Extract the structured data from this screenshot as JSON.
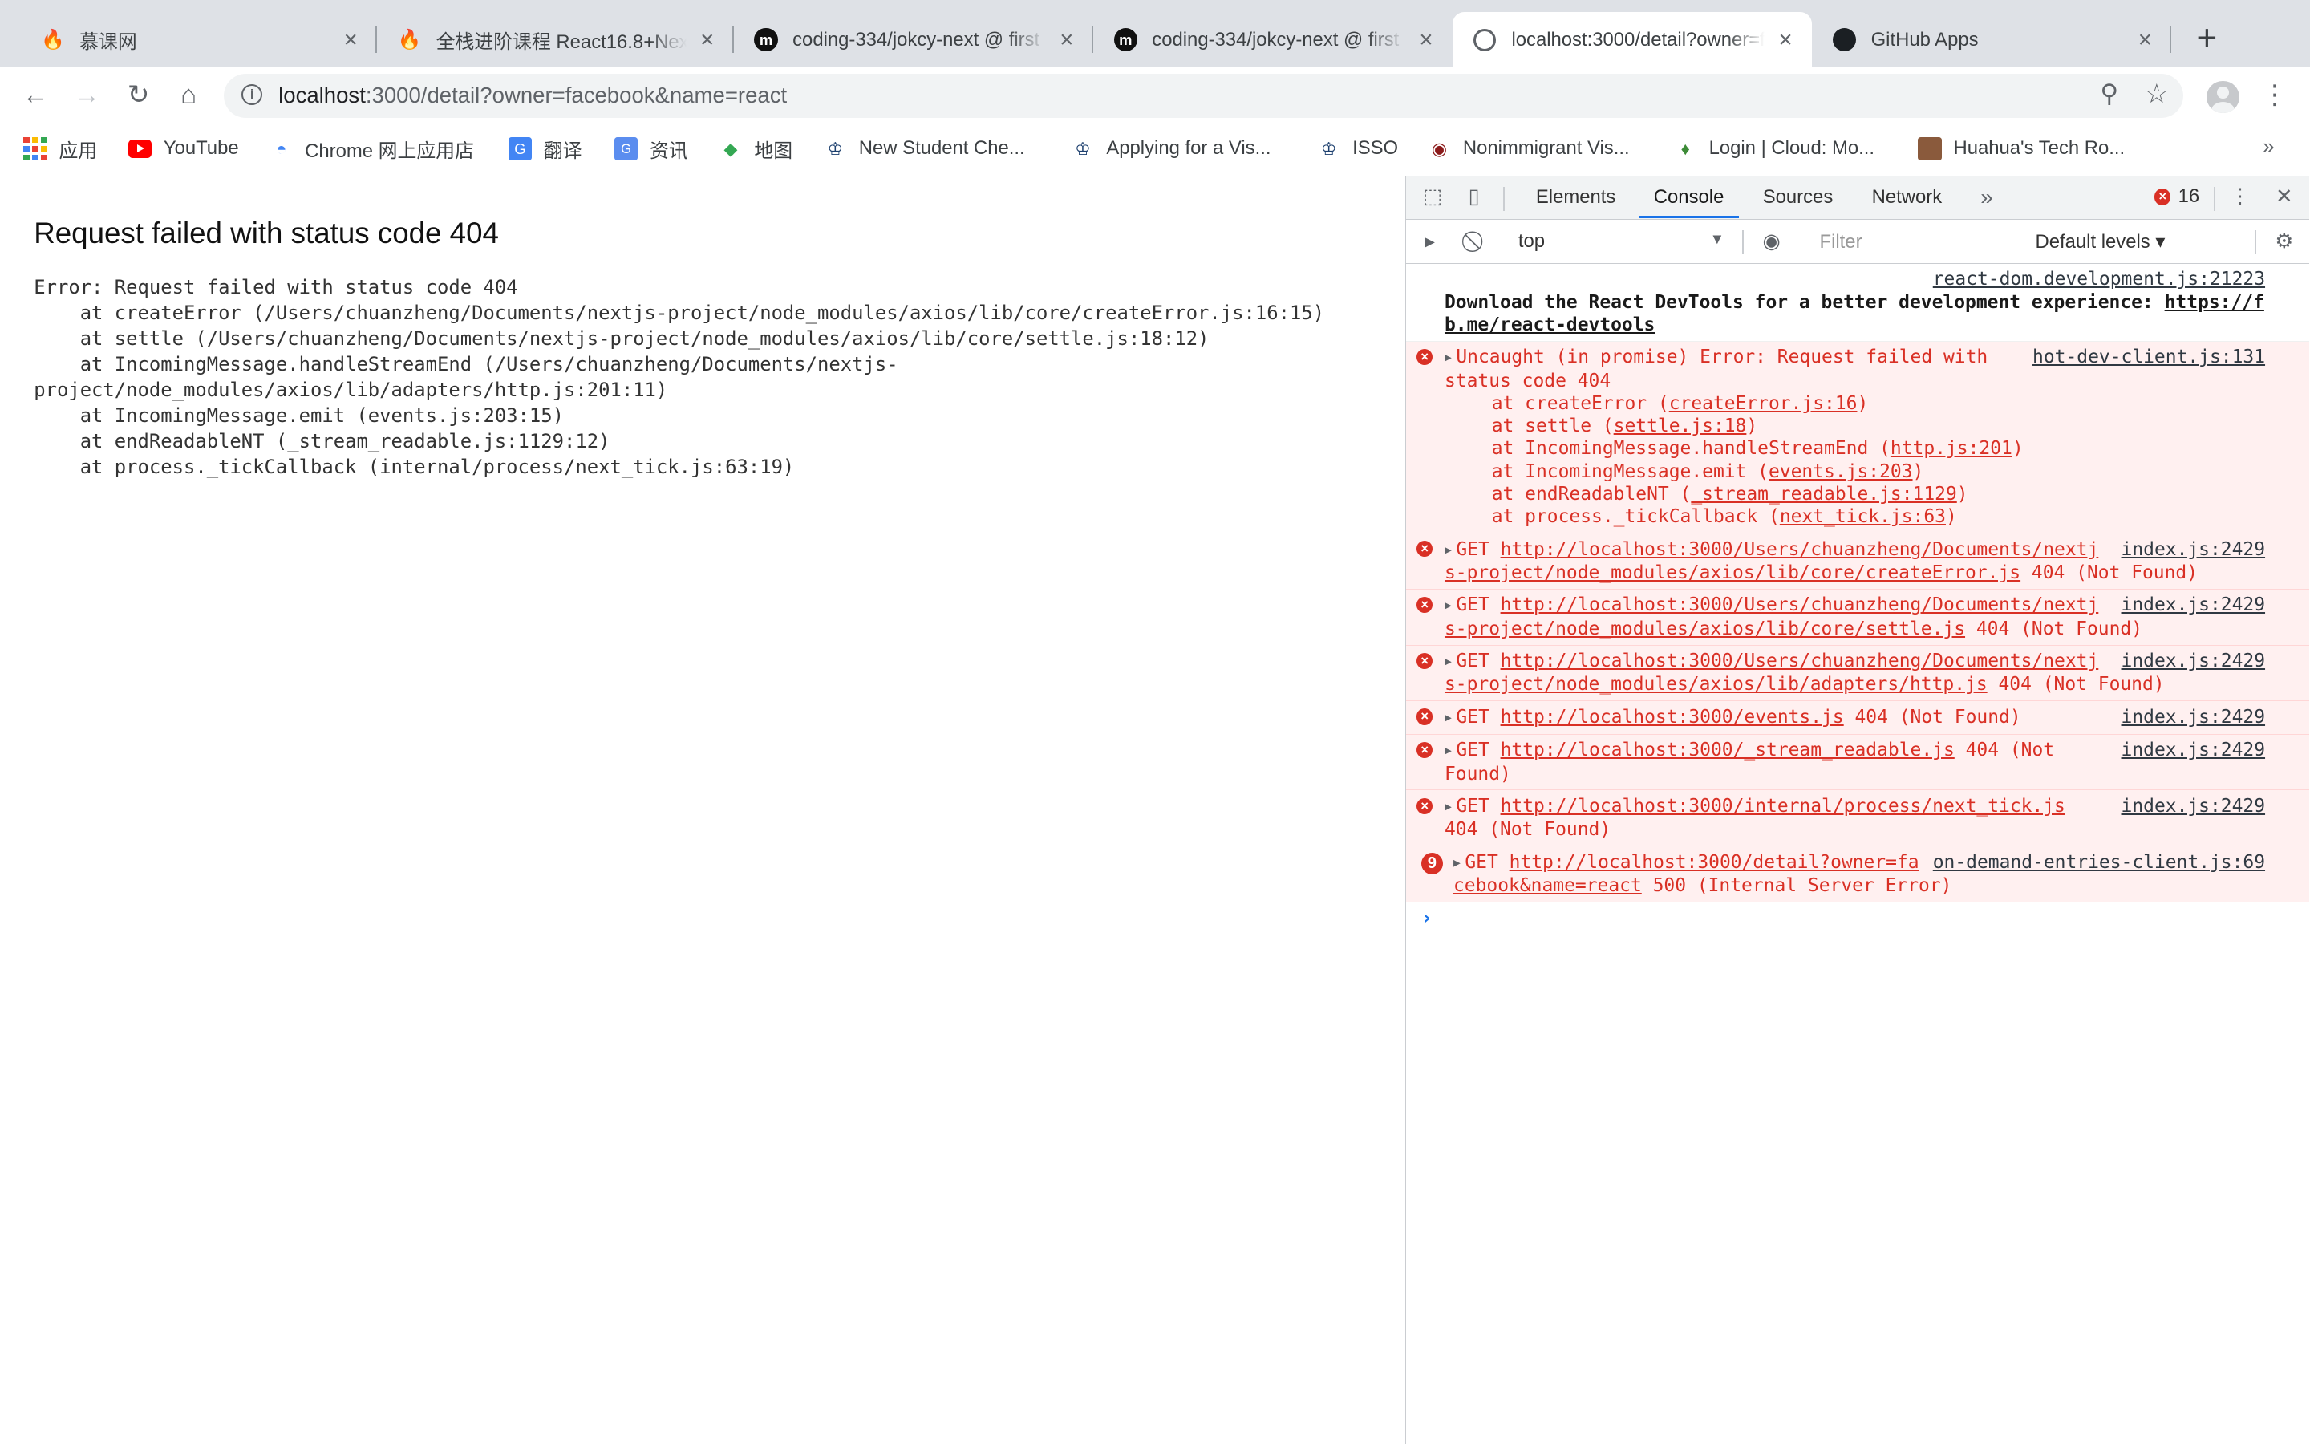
{
  "tabs": [
    {
      "title": "慕课网",
      "icon": "fire-icon"
    },
    {
      "title": "全栈进阶课程 React16.8+Next.js+Koa2",
      "icon": "fire-icon"
    },
    {
      "title": "coding-334/jokcy-next @ first",
      "icon": "m-logo-icon"
    },
    {
      "title": "coding-334/jokcy-next @ first",
      "icon": "m-logo-icon"
    },
    {
      "title": "localhost:3000/detail?owner=facebook&name=react",
      "icon": "globe-icon",
      "active": true
    },
    {
      "title": "GitHub Apps",
      "icon": "github-icon"
    }
  ],
  "toolbar": {
    "url_host": "localhost",
    "url_rest": ":3000/detail?owner=facebook&name=react"
  },
  "bookmarks": [
    {
      "label": "应用",
      "icon": "apps-grid-icon"
    },
    {
      "label": "YouTube",
      "icon": "youtube-icon"
    },
    {
      "label": "Chrome 网上应用店",
      "icon": "chrome-store-icon"
    },
    {
      "label": "翻译",
      "icon": "translate-icon"
    },
    {
      "label": "资讯",
      "icon": "news-icon"
    },
    {
      "label": "地图",
      "icon": "maps-icon"
    },
    {
      "label": "New Student Che...",
      "icon": "crown-icon"
    },
    {
      "label": "Applying for a Vis...",
      "icon": "crown-icon"
    },
    {
      "label": "ISSO",
      "icon": "crown-icon"
    },
    {
      "label": "Nonimmigrant Vis...",
      "icon": "seal-icon"
    },
    {
      "label": "Login | Cloud: Mo...",
      "icon": "leaf-icon"
    },
    {
      "label": "Huahua's Tech Ro...",
      "icon": "photo-icon"
    }
  ],
  "page": {
    "heading": "Request failed with status code 404",
    "stack": "Error: Request failed with status code 404\n    at createError (/Users/chuanzheng/Documents/nextjs-project/node_modules/axios/lib/core/createError.js:16:15)\n    at settle (/Users/chuanzheng/Documents/nextjs-project/node_modules/axios/lib/core/settle.js:18:12)\n    at IncomingMessage.handleStreamEnd (/Users/chuanzheng/Documents/nextjs-\nproject/node_modules/axios/lib/adapters/http.js:201:11)\n    at IncomingMessage.emit (events.js:203:15)\n    at endReadableNT (_stream_readable.js:1129:12)\n    at process._tickCallback (internal/process/next_tick.js:63:19)"
  },
  "devtools": {
    "tabs": [
      "Elements",
      "Console",
      "Sources",
      "Network"
    ],
    "active_tab": "Console",
    "error_count": "16",
    "context": "top",
    "filter_placeholder": "Filter",
    "levels": "Default levels ▾",
    "devtools_msg": {
      "source": "react-dom.development.js:21223",
      "text": "Download the React DevTools for a better development experience: ",
      "link": "https://fb.me/react-devtools"
    },
    "uncaught": {
      "source": "hot-dev-client.js:131",
      "head": "Uncaught (in promise) Error: Request failed with status code 404",
      "stack": [
        {
          "pre": "at createError (",
          "link": "createError.js:16",
          "post": ")"
        },
        {
          "pre": "at settle (",
          "link": "settle.js:18",
          "post": ")"
        },
        {
          "pre": "at IncomingMessage.handleStreamEnd (",
          "link": "http.js:201",
          "post": ")"
        },
        {
          "pre": "at IncomingMessage.emit (",
          "link": "events.js:203",
          "post": ")"
        },
        {
          "pre": "at endReadableNT (",
          "link": "_stream_readable.js:1129",
          "post": ")"
        },
        {
          "pre": "at process._tickCallback (",
          "link": "next_tick.js:63",
          "post": ")"
        }
      ]
    },
    "gets": [
      {
        "url": "http://localhost:3000/Users/chuanzheng/Documents/nextjs-project/node_modules/axios/lib/core/createError.js",
        "status": "404 (Not Found)",
        "source": "index.js:2429"
      },
      {
        "url": "http://localhost:3000/Users/chuanzheng/Documents/nextjs-project/node_modules/axios/lib/core/settle.js",
        "status": "404 (Not Found)",
        "source": "index.js:2429"
      },
      {
        "url": "http://localhost:3000/Users/chuanzheng/Documents/nextjs-project/node_modules/axios/lib/adapters/http.js",
        "status": "404 (Not Found)",
        "source": "index.js:2429"
      },
      {
        "url": "http://localhost:3000/events.js",
        "status": "404 (Not Found)",
        "source": "index.js:2429"
      },
      {
        "url": "http://localhost:3000/_stream_readable.js",
        "status": "404 (Not Found)",
        "source": "index.js:2429"
      },
      {
        "url": "http://localhost:3000/internal/process/next_tick.js",
        "status": "404 (Not Found)",
        "source": "index.js:2429"
      }
    ],
    "last_get": {
      "count": "9",
      "url": "http://localhost:3000/detail?owner=facebook&name=react",
      "status": "500 (Internal Server Error)",
      "source": "on-demand-entries-client.js:69"
    },
    "get_prefix": "GET"
  }
}
